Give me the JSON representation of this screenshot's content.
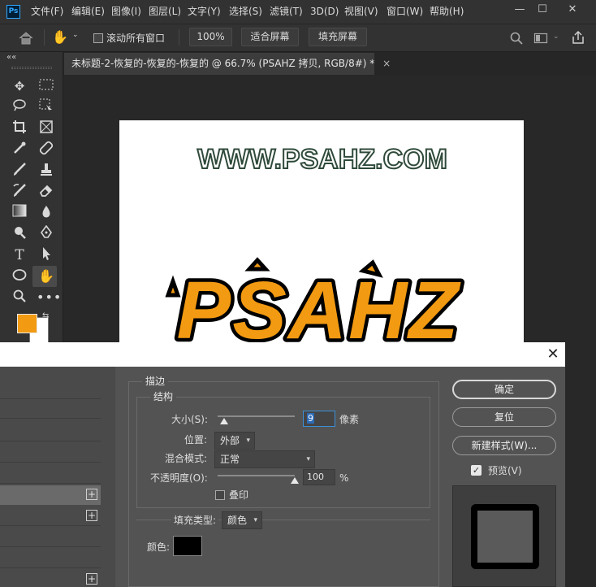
{
  "app": {
    "logo_text": "Ps"
  },
  "menu": {
    "items": [
      "文件(F)",
      "编辑(E)",
      "图像(I)",
      "图层(L)",
      "文字(Y)",
      "选择(S)",
      "滤镜(T)",
      "3D(D)",
      "视图(V)",
      "窗口(W)",
      "帮助(H)"
    ]
  },
  "window_controls": {
    "minimize": "—",
    "maximize": "☐",
    "close": "✕"
  },
  "options_bar": {
    "scroll_all_label": "滚动所有窗口",
    "zoom_100": "100%",
    "fit_screen": "适合屏幕",
    "fill_screen": "填充屏幕"
  },
  "tab": {
    "title": "未标题-2-恢复的-恢复的-恢复的 @ 66.7% (PSAHZ 拷贝, RGB/8#) *",
    "close": "×"
  },
  "panel_collapse": "««",
  "canvas": {
    "top_text": "WWW.PSAHZ.COM",
    "main_text": "PSAHZ"
  },
  "colors": {
    "foreground": "#f29a12",
    "background": "#ffffff",
    "stroke_color": "#000000",
    "accent": "#31a8ff"
  },
  "dialog": {
    "close": "✕",
    "section_title": "描边",
    "structure_label": "结构",
    "size_label": "大小(S):",
    "size_value": "9",
    "size_unit": "像素",
    "size_slider": 0.045,
    "position_label": "位置:",
    "position_value": "外部",
    "blend_label": "混合模式:",
    "blend_value": "正常",
    "opacity_label": "不透明度(O):",
    "opacity_value": "100",
    "opacity_unit": "%",
    "opacity_slider": 1.0,
    "overprint_label": "叠印",
    "fill_type_label": "填充类型:",
    "fill_type_value": "颜色",
    "color_label": "颜色:",
    "buttons": {
      "ok": "确定",
      "reset": "复位",
      "new_style": "新建样式(W)...",
      "preview": "预览(V)"
    },
    "preview_checked": true,
    "plus": "+"
  }
}
